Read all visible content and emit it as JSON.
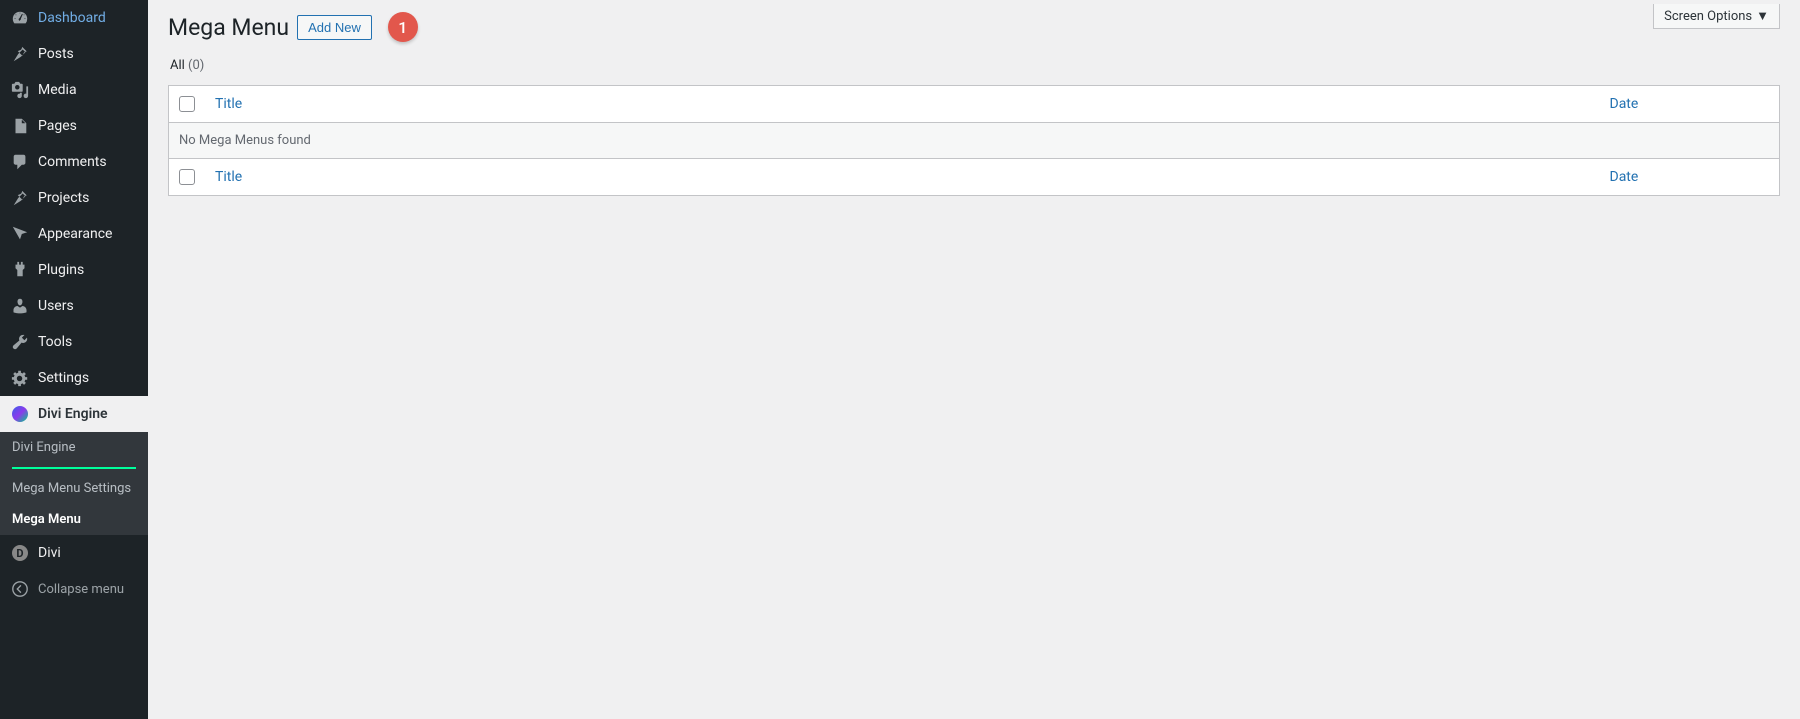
{
  "sidebar": {
    "items": [
      {
        "label": "Dashboard",
        "icon": "dashboard"
      },
      {
        "label": "Posts",
        "icon": "pin"
      },
      {
        "label": "Media",
        "icon": "media"
      },
      {
        "label": "Pages",
        "icon": "pages"
      },
      {
        "label": "Comments",
        "icon": "comments"
      },
      {
        "label": "Projects",
        "icon": "pin"
      },
      {
        "label": "Appearance",
        "icon": "appearance"
      },
      {
        "label": "Plugins",
        "icon": "plugins"
      },
      {
        "label": "Users",
        "icon": "users"
      },
      {
        "label": "Tools",
        "icon": "tools"
      },
      {
        "label": "Settings",
        "icon": "settings"
      }
    ],
    "active_plugin": "Divi Engine",
    "submenu": [
      {
        "label": "Divi Engine"
      },
      {
        "label": "Mega Menu Settings"
      },
      {
        "label": "Mega Menu",
        "current": true
      }
    ],
    "divi_label": "Divi",
    "collapse_label": "Collapse menu"
  },
  "screen_options_label": "Screen Options",
  "page": {
    "title": "Mega Menu",
    "add_new_label": "Add New",
    "step_number": "1"
  },
  "filter": {
    "all_label": "All",
    "count_text": "(0)"
  },
  "table": {
    "columns": {
      "title": "Title",
      "date": "Date"
    },
    "empty_message": "No Mega Menus found"
  }
}
